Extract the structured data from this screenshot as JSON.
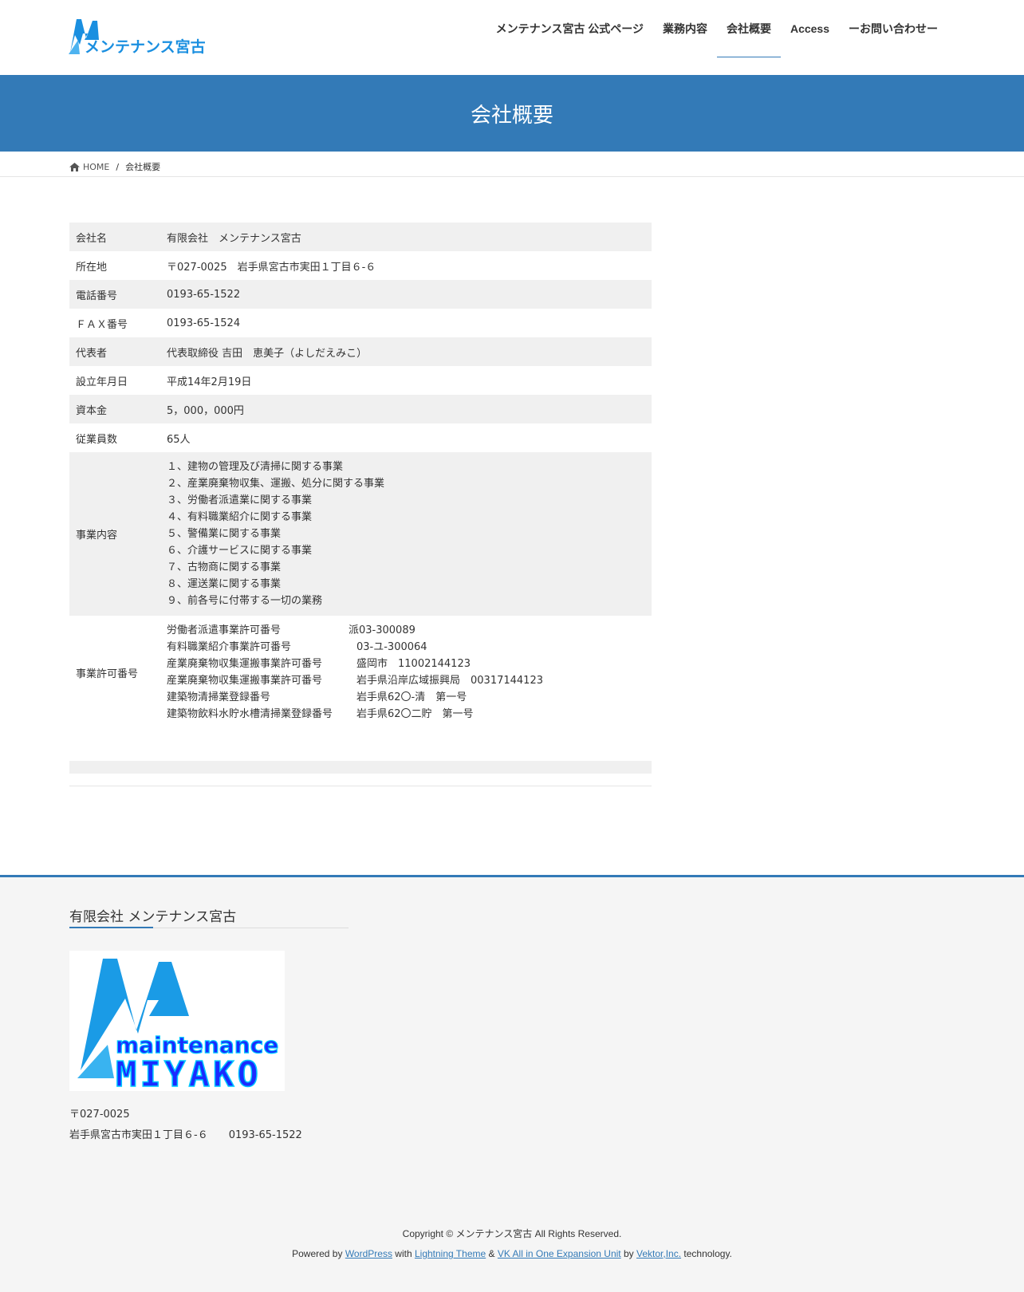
{
  "header": {
    "logo_text": "メンテナンス宮古",
    "nav": [
      {
        "label": "メンテナンス宮古 公式ページ"
      },
      {
        "label": "業務内容"
      },
      {
        "label": "会社概要"
      },
      {
        "label": "Access"
      },
      {
        "label": "ーお問い合わせー"
      }
    ],
    "active_nav": "会社概要"
  },
  "page_title": "会社概要",
  "breadcrumb": {
    "home": "HOME",
    "separator": "/",
    "current": "会社概要"
  },
  "company_table": {
    "rows": [
      {
        "label": "会社名",
        "value": "有限会社　メンテナンス宮古"
      },
      {
        "label": "所在地",
        "value": "〒027-0025　岩手県宮古市実田１丁目６-６"
      },
      {
        "label": "電話番号",
        "value": "0193-65-1522"
      },
      {
        "label": "ＦＡＸ番号",
        "value": "0193-65-1524"
      },
      {
        "label": "代表者",
        "value": "代表取締役 吉田　恵美子（よしだえみこ）"
      },
      {
        "label": "設立年月日",
        "value": "平成14年2月19日"
      },
      {
        "label": "資本金",
        "value": "5，000，000円"
      },
      {
        "label": "従業員数",
        "value": "65人"
      }
    ],
    "business": {
      "label": "事業内容",
      "items": [
        "１、建物の管理及び清掃に関する事業",
        "２、産業廃棄物収集、運搬、処分に関する事業",
        "３、労働者派遣業に関する事業",
        "４、有料職業紹介に関する事業",
        "５、警備業に関する事業",
        "６、介護サービスに関する事業",
        "７、古物商に関する事業",
        "８、運送業に関する事業",
        "９、前各号に付帯する一切の業務"
      ]
    },
    "permits": {
      "label": "事業許可番号",
      "items": [
        {
          "name": "労働者派遣事業許可番号",
          "number": "派03-300089"
        },
        {
          "name": "有料職業紹介事業許可番号",
          "number": "03-ユ-300064"
        },
        {
          "name": "産業廃棄物収集運搬事業許可番号",
          "number": "盛岡市　11002144123"
        },
        {
          "name": "産業廃棄物収集運搬事業許可番号",
          "number": "岩手県沿岸広域振興局　00317144123"
        },
        {
          "name": "建築物清掃業登録番号",
          "number": "岩手県62〇-清　第一号"
        },
        {
          "name": "建築物飲料水貯水槽清掃業登録番号",
          "number": "岩手県62〇二貯　第一号"
        }
      ]
    }
  },
  "footer": {
    "title": "有限会社 メンテナンス宮古",
    "logo_line1": "maintenance",
    "logo_line2": "MIYAKO",
    "postal": "〒027-0025",
    "address_phone": "岩手県宮古市実田１丁目６-６　　0193-65-1522",
    "copyright": "Copyright © メンテナンス宮古 All Rights Reserved.",
    "powered": {
      "prefix": "Powered by",
      "wordpress": "WordPress",
      "with": "with",
      "lightning": "Lightning Theme",
      "amp": "&",
      "vk": "VK All in One Expansion Unit",
      "by": "by",
      "vektor": "Vektor,Inc.",
      "suffix": "technology."
    }
  },
  "colors": {
    "accent": "#337ab7",
    "logo_blue": "#1a8fe0",
    "table_shade": "#f0f0f0"
  }
}
